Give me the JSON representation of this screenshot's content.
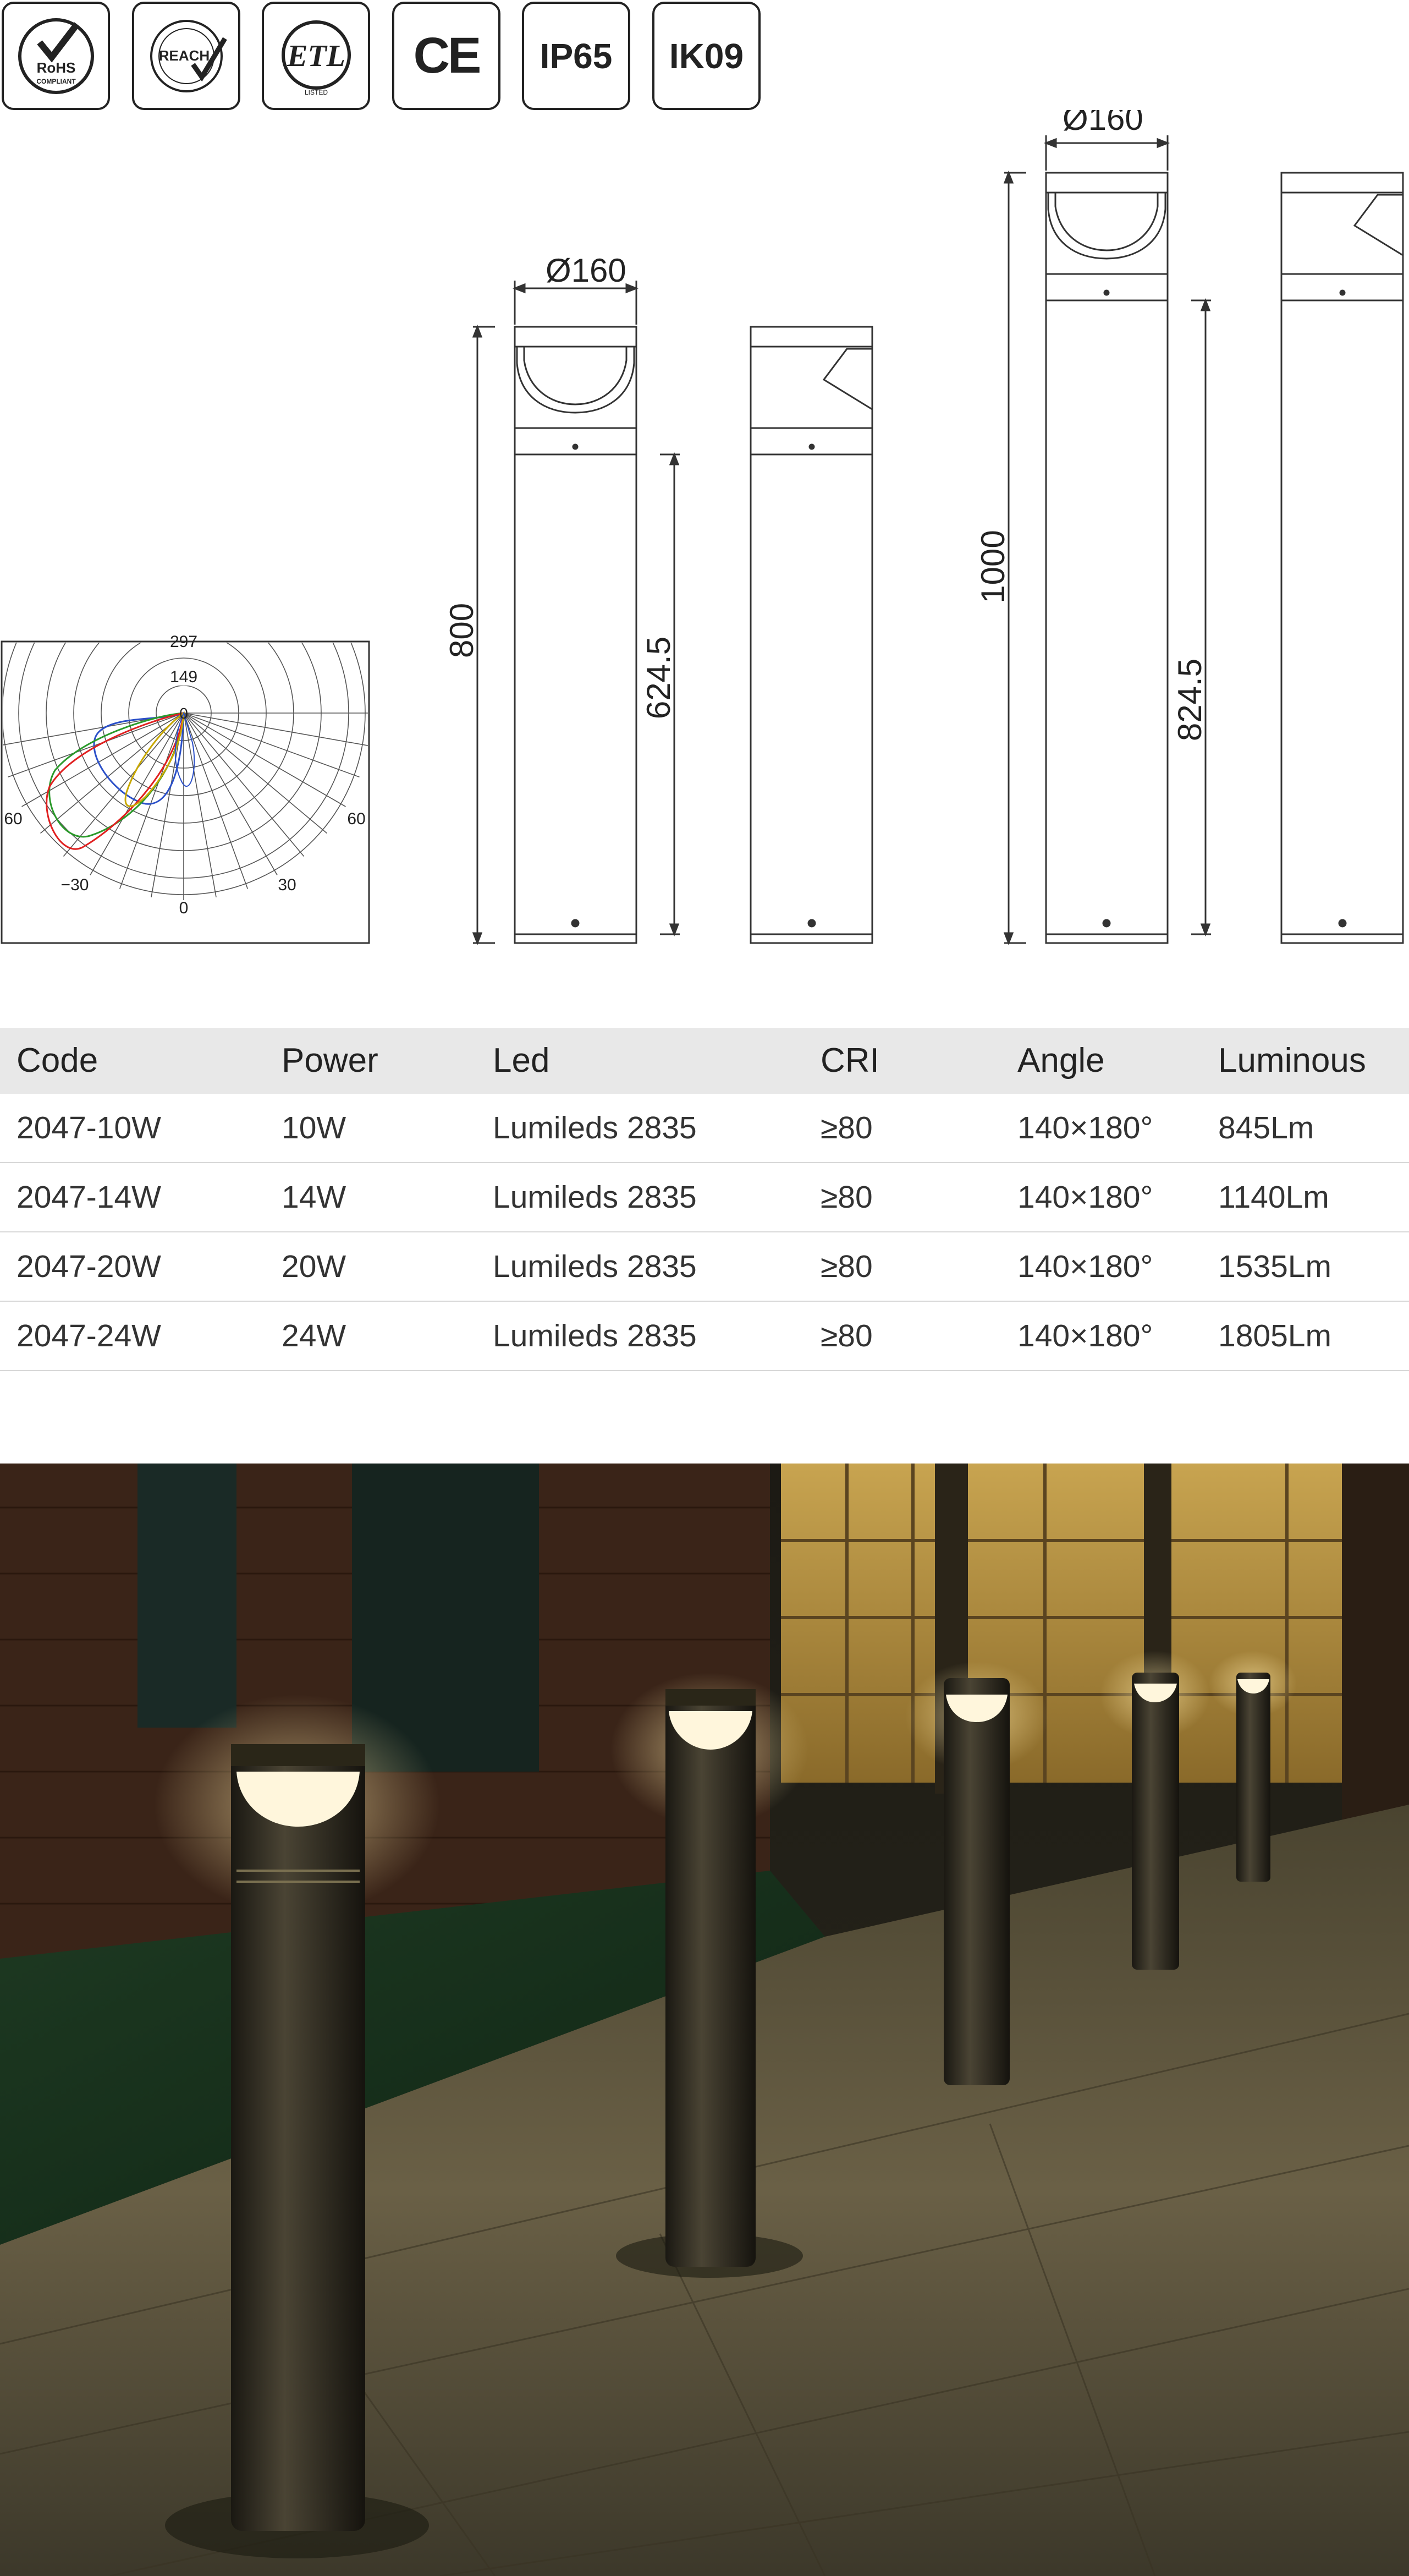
{
  "certifications": [
    {
      "name": "RoHS",
      "sub": "COMPLIANT",
      "kind": "rohs-badge"
    },
    {
      "name": "REACH",
      "kind": "reach-badge"
    },
    {
      "name": "ETL",
      "sub": "LISTED",
      "kind": "etl-badge"
    },
    {
      "name": "CE",
      "kind": "ce-badge"
    },
    {
      "name": "IP65",
      "kind": "text-badge"
    },
    {
      "name": "IK09",
      "kind": "text-badge"
    }
  ],
  "photometric": {
    "ring_label": "149",
    "top_label": "297",
    "center_label": "0",
    "angle_labels": {
      "left": "60",
      "right": "60",
      "bottom_left": "−30",
      "bottom_center": "0",
      "bottom_right": "30"
    },
    "curve_colors": [
      "#2a4fc8",
      "#2a9a2a",
      "#e02020",
      "#c8a800"
    ]
  },
  "dimensions": {
    "short": {
      "diameter": "Ø160",
      "height": "800",
      "inner_height": "624.5"
    },
    "tall": {
      "diameter": "Ø160",
      "height": "1000",
      "inner_height": "824.5"
    }
  },
  "table": {
    "headers": [
      "Code",
      "Power",
      "Led",
      "CRI",
      "Angle",
      "Luminous"
    ],
    "rows": [
      [
        "2047-10W",
        "10W",
        "Lumileds 2835",
        "≥80",
        "140×180°",
        "845Lm"
      ],
      [
        "2047-14W",
        "14W",
        "Lumileds 2835",
        "≥80",
        "140×180°",
        "1140Lm"
      ],
      [
        "2047-20W",
        "20W",
        "Lumileds 2835",
        "≥80",
        "140×180°",
        "1535Lm"
      ],
      [
        "2047-24W",
        "24W",
        "Lumileds 2835",
        "≥80",
        "140×180°",
        "1805Lm"
      ]
    ]
  },
  "colors": {
    "line": "#333333",
    "table_header_bg": "#e8e8e8",
    "lamp_glow": "#ffe9a8"
  }
}
